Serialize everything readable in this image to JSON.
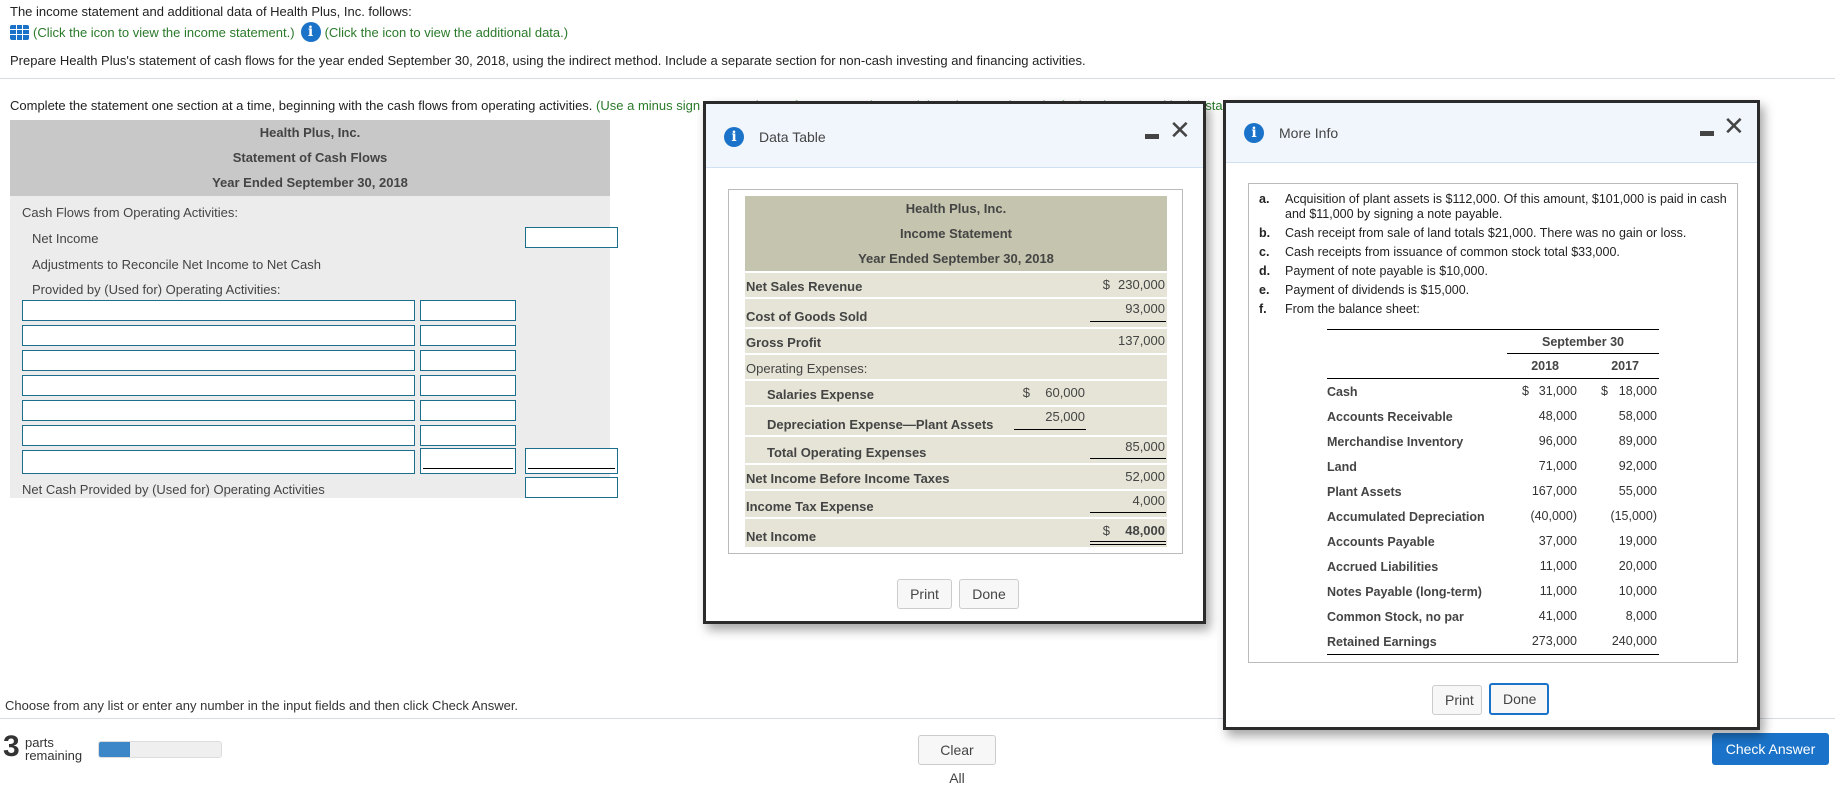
{
  "intro_text": "The income statement and additional data of Health Plus, Inc. follows:",
  "links": {
    "income_statement": "(Click the icon to view the income statement.)",
    "additional_data": "(Click the icon to view the additional data.)"
  },
  "prompt": "Prepare Health Plus's statement of cash flows for the year ended September 30, 2018, using the indirect method. Include a separate section for non-cash investing and financing activities.",
  "instruction": {
    "main": "Complete the statement one section at a time, beginning with the cash flows from operating activities.",
    "hint": "(Use a minus sign or parentheses for amounts that result in a decrease in cash. If a box is not used in the sta"
  },
  "statement": {
    "company": "Health Plus, Inc.",
    "title": "Statement of Cash Flows",
    "period": "Year Ended September 30, 2018",
    "section_header": "Cash Flows from Operating Activities:",
    "net_income_label": "Net Income",
    "adjust_label_1": "Adjustments to Reconcile Net Income to Net Cash",
    "adjust_label_2": "Provided by (Used for) Operating Activities:",
    "net_cash_label": "Net Cash Provided by (Used for) Operating Activities",
    "inputs": {
      "net_income": "",
      "rows": [
        {
          "account": "",
          "amount": ""
        },
        {
          "account": "",
          "amount": ""
        },
        {
          "account": "",
          "amount": ""
        },
        {
          "account": "",
          "amount": ""
        },
        {
          "account": "",
          "amount": ""
        },
        {
          "account": "",
          "amount": ""
        },
        {
          "account": "",
          "amount": "",
          "total": ""
        }
      ],
      "net_cash": ""
    }
  },
  "data_table_dialog": {
    "title": "Data Table",
    "company": "Health Plus, Inc.",
    "statement": "Income Statement",
    "period": "Year Ended September 30, 2018",
    "rows": {
      "net_sales": {
        "label": "Net Sales Revenue",
        "currency": "$",
        "value": "230,000"
      },
      "cogs": {
        "label": "Cost of Goods Sold",
        "value": "93,000"
      },
      "gross_profit": {
        "label": "Gross Profit",
        "value": "137,000"
      },
      "opex_header": {
        "label": "Operating Expenses:"
      },
      "salaries": {
        "label": "Salaries Expense",
        "currency": "$",
        "value": "60,000"
      },
      "depreciation": {
        "label": "Depreciation Expense—Plant Assets",
        "value": "25,000"
      },
      "total_opex": {
        "label": "Total Operating Expenses",
        "value": "85,000"
      },
      "ni_before_tax": {
        "label": "Net Income Before Income Taxes",
        "value": "52,000"
      },
      "tax": {
        "label": "Income Tax Expense",
        "value": "4,000"
      },
      "net_income": {
        "label": "Net Income",
        "currency": "$",
        "value": "48,000"
      }
    },
    "print_label": "Print",
    "done_label": "Done"
  },
  "more_info_dialog": {
    "title": "More Info",
    "items": [
      {
        "letter": "a.",
        "text": "Acquisition of plant assets is $112,000. Of this amount, $101,000 is paid in cash and $11,000 by signing a note payable."
      },
      {
        "letter": "b.",
        "text": "Cash receipt from sale of land totals $21,000. There was no gain or loss."
      },
      {
        "letter": "c.",
        "text": "Cash receipts from issuance of common stock total $33,000."
      },
      {
        "letter": "d.",
        "text": "Payment of note payable is $10,000."
      },
      {
        "letter": "e.",
        "text": "Payment of dividends is $15,000."
      },
      {
        "letter": "f.",
        "text": "From the balance sheet:"
      }
    ],
    "balance_sheet": {
      "header": "September 30",
      "years": [
        "2018",
        "2017"
      ],
      "rows": [
        {
          "label": "Cash",
          "v2018": "31,000",
          "v2017": "18,000",
          "currency": "$"
        },
        {
          "label": "Accounts Receivable",
          "v2018": "48,000",
          "v2017": "58,000"
        },
        {
          "label": "Merchandise Inventory",
          "v2018": "96,000",
          "v2017": "89,000"
        },
        {
          "label": "Land",
          "v2018": "71,000",
          "v2017": "92,000"
        },
        {
          "label": "Plant Assets",
          "v2018": "167,000",
          "v2017": "55,000"
        },
        {
          "label": "Accumulated Depreciation",
          "v2018": "(40,000)",
          "v2017": "(15,000)"
        },
        {
          "label": "Accounts Payable",
          "v2018": "37,000",
          "v2017": "19,000"
        },
        {
          "label": "Accrued Liabilities",
          "v2018": "11,000",
          "v2017": "20,000"
        },
        {
          "label": "Notes Payable (long-term)",
          "v2018": "11,000",
          "v2017": "10,000"
        },
        {
          "label": "Common Stock, no par",
          "v2018": "41,000",
          "v2017": "8,000"
        },
        {
          "label": "Retained Earnings",
          "v2018": "273,000",
          "v2017": "240,000"
        }
      ]
    },
    "print_label": "Print",
    "done_label": "Done"
  },
  "footer": {
    "message": "Choose from any list or enter any number in the input fields and then click Check Answer.",
    "parts_count": "3",
    "parts_label_1": "parts",
    "parts_label_2": "remaining",
    "progress_fraction": 0.25,
    "clear_all_label": "Clear All",
    "check_answer_label": "Check Answer"
  }
}
